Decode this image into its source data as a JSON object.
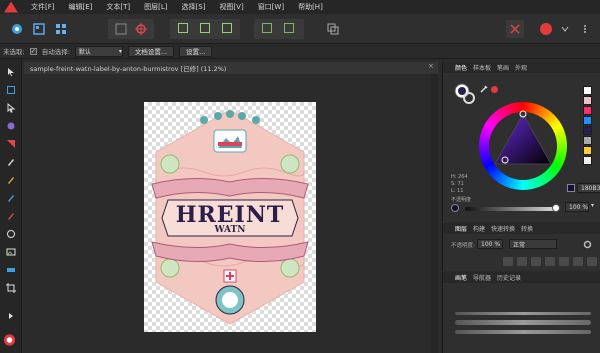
{
  "menubar": {
    "items": [
      "文件[F]",
      "编辑[E]",
      "文本[T]",
      "图层[L]",
      "选择[S]",
      "视图[V]",
      "窗口[W]",
      "帮助[H]"
    ]
  },
  "contextbar": {
    "unselected_label": "未选取:",
    "auto_select_label": "自动选择:",
    "auto_select_value": "默认",
    "doc_settings_button": "文档设置...",
    "preferences_button": "设置..."
  },
  "document": {
    "tab_title": "sample-freint-watn-label-by-anton-burmistrov [已修] (11.2%)",
    "close_glyph": "×"
  },
  "artwork": {
    "title": "HREINT",
    "subtitle": "WATN",
    "colors": {
      "pink": "#f3c8c0",
      "navy": "#2a1f4a",
      "teal": "#5aa9a8",
      "green": "#8fbf6f",
      "banner": "#e8a9b6"
    }
  },
  "color_panel": {
    "tabs": [
      "颜色",
      "样本板",
      "笔画",
      "外观"
    ],
    "hex_value": "180B3D",
    "opacity_label": "不透明度",
    "opacity_value": "100 %",
    "hsl_readout": [
      "H: 264",
      "S: 71",
      "L: 11"
    ],
    "swatch_colors": [
      "#ffffff",
      "#e8c3c8",
      "#ff2d6f",
      "#1e90ff",
      "#2a1f4a",
      "#aaaaaa",
      "#ffcc33",
      "#eeeeee"
    ]
  },
  "layers_panel": {
    "tabs": [
      "图层",
      "构建",
      "快速转换",
      "转换"
    ],
    "opacity_label": "不透明度:",
    "opacity_value": "100 %",
    "blend_value": "正常"
  },
  "brushes_panel": {
    "tabs": [
      "画笔",
      "导航器",
      "历史记录"
    ]
  }
}
